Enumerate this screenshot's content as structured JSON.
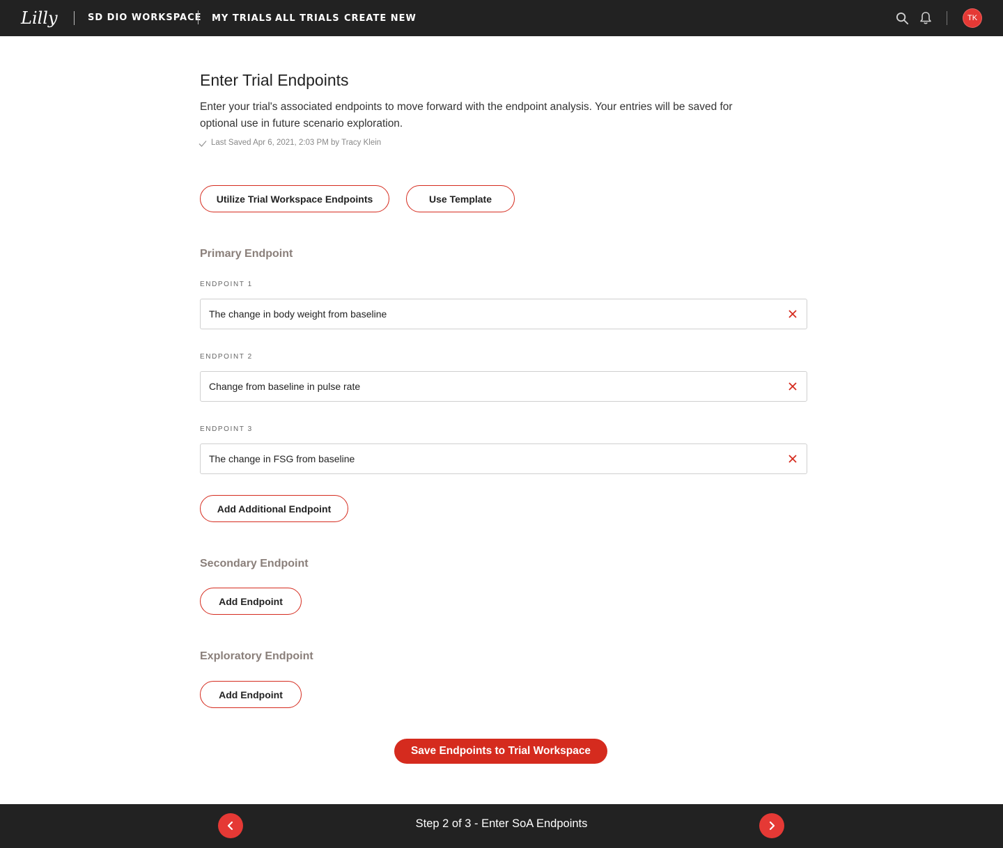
{
  "header": {
    "logo_text": "Lilly",
    "workspace_name": "SD DIO WORKSPACE",
    "nav": [
      "MY TRIALS",
      "ALL TRIALS",
      "CREATE NEW"
    ],
    "avatar_initials": "TK"
  },
  "main": {
    "title": "Enter Trial Endpoints",
    "description": "Enter your trial's associated endpoints to move forward with the endpoint analysis. Your entries will be saved for optional use in future scenario exploration.",
    "last_saved": "Last Saved Apr 6, 2021, 2:03 PM by Tracy Klein",
    "utilize_button": "Utilize Trial Workspace Endpoints",
    "template_button": "Use Template",
    "primary": {
      "title": "Primary Endpoint",
      "endpoints": [
        {
          "label": "ENDPOINT 1",
          "value": "The change in body weight from baseline"
        },
        {
          "label": "ENDPOINT 2",
          "value": "Change from baseline in pulse rate"
        },
        {
          "label": "ENDPOINT 3",
          "value": "The change in FSG from baseline"
        }
      ],
      "add_button": "Add Additional Endpoint"
    },
    "secondary": {
      "title": "Secondary Endpoint",
      "add_button": "Add Endpoint"
    },
    "exploratory": {
      "title": "Exploratory Endpoint",
      "add_button": "Add Endpoint"
    },
    "save_button": "Save Endpoints to Trial Workspace"
  },
  "footer": {
    "step_text": "Step 2 of 3 - Enter SoA Endpoints"
  },
  "colors": {
    "accent": "#d52b1e",
    "header_bg": "#222222",
    "section_title": "#8a7f7a"
  }
}
